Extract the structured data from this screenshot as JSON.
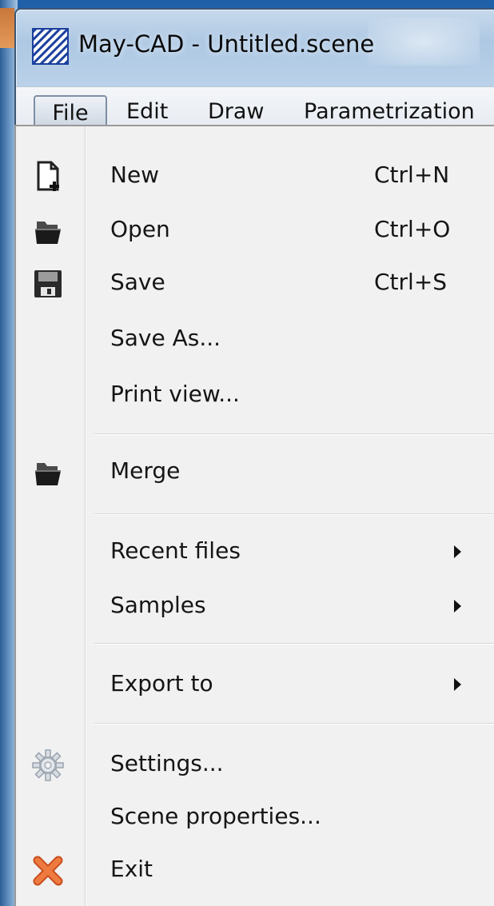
{
  "window": {
    "title": "May-CAD - Untitled.scene",
    "app_icon": "hatched-square-icon"
  },
  "menubar": {
    "items": [
      {
        "label": "File",
        "active": true
      },
      {
        "label": "Edit"
      },
      {
        "label": "Draw"
      },
      {
        "label": "Parametrization"
      }
    ]
  },
  "file_menu": {
    "items": [
      {
        "label": "New",
        "shortcut": "Ctrl+N",
        "icon": "new-document-icon"
      },
      {
        "label": "Open",
        "shortcut": "Ctrl+O",
        "icon": "folder-icon"
      },
      {
        "label": "Save",
        "shortcut": "Ctrl+S",
        "icon": "floppy-disk-icon"
      },
      {
        "label": "Save As..."
      },
      {
        "label": "Print view..."
      },
      {
        "label": "Merge",
        "icon": "folder-icon"
      },
      {
        "label": "Recent files",
        "submenu": true
      },
      {
        "label": "Samples",
        "submenu": true
      },
      {
        "label": "Export to",
        "submenu": true
      },
      {
        "label": "Settings...",
        "icon": "gear-icon"
      },
      {
        "label": "Scene properties..."
      },
      {
        "label": "Exit",
        "icon": "close-x-icon"
      }
    ]
  },
  "colors": {
    "title_bar": "#bcd3ea",
    "menu_background": "#f1f1f1",
    "exit_icon": "#e0622a"
  }
}
